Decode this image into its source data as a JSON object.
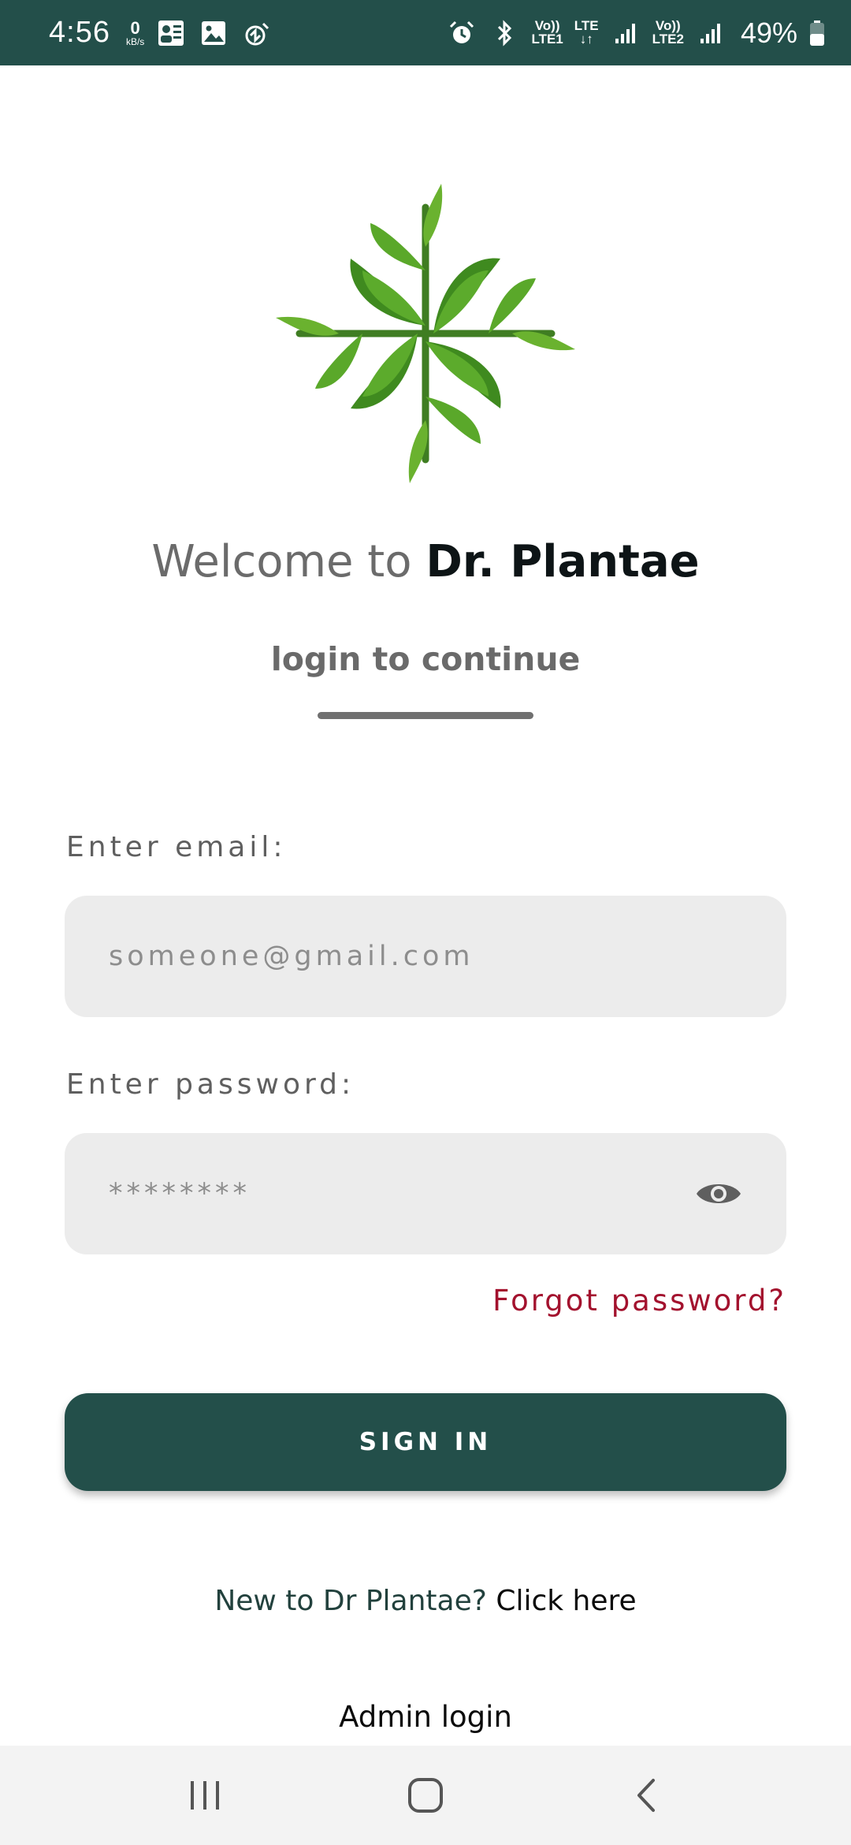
{
  "status_bar": {
    "time": "4:56",
    "speed_value": "0",
    "speed_unit": "kB/s",
    "net1_top": "Vo))",
    "net1_bottom": "LTE1",
    "net_lte": "LTE",
    "net2_top": "Vo))",
    "net2_bottom": "LTE2",
    "battery": "49%",
    "icons": [
      "kb-speed-icon",
      "profile-icon",
      "gallery-icon",
      "power-saving-icon",
      "alarm-icon",
      "bluetooth-icon",
      "signal-icon",
      "battery-icon"
    ]
  },
  "welcome": {
    "prefix": "Welcome to ",
    "brand": "Dr. Plantae"
  },
  "subtitle": "login to continue",
  "form": {
    "email_label": "Enter email:",
    "email_placeholder": "someone@gmail.com",
    "password_label": "Enter password:",
    "password_placeholder": "********",
    "forgot": "Forgot password?",
    "signin": "SIGN IN"
  },
  "register": {
    "prompt": "New to Dr Plantae? ",
    "link": "Click here"
  },
  "admin_login": "Admin login",
  "colors": {
    "primary": "#234f4a",
    "accent_red": "#a3122e",
    "field_bg": "#ececec",
    "leaf_green": "#5aa82a"
  }
}
